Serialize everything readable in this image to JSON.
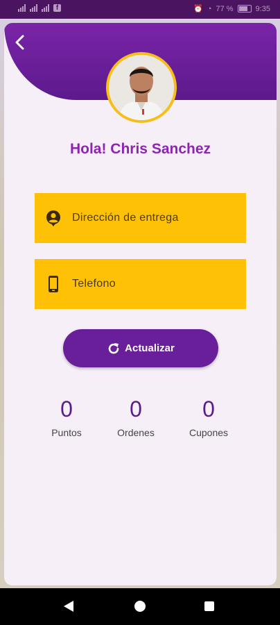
{
  "status_bar": {
    "time": "9:35",
    "battery": "77 %"
  },
  "profile": {
    "greeting": "Hola! Chris Sanchez"
  },
  "form": {
    "address_label": "Dirección de entrega",
    "phone_label": "Telefono",
    "update_label": "Actualizar"
  },
  "stats": [
    {
      "value": "0",
      "label": "Puntos"
    },
    {
      "value": "0",
      "label": "Ordenes"
    },
    {
      "value": "0",
      "label": "Cupones"
    }
  ],
  "colors": {
    "accent_purple": "#6a1f9a",
    "field_yellow": "#ffc105",
    "avatar_ring": "#f7be1b"
  }
}
